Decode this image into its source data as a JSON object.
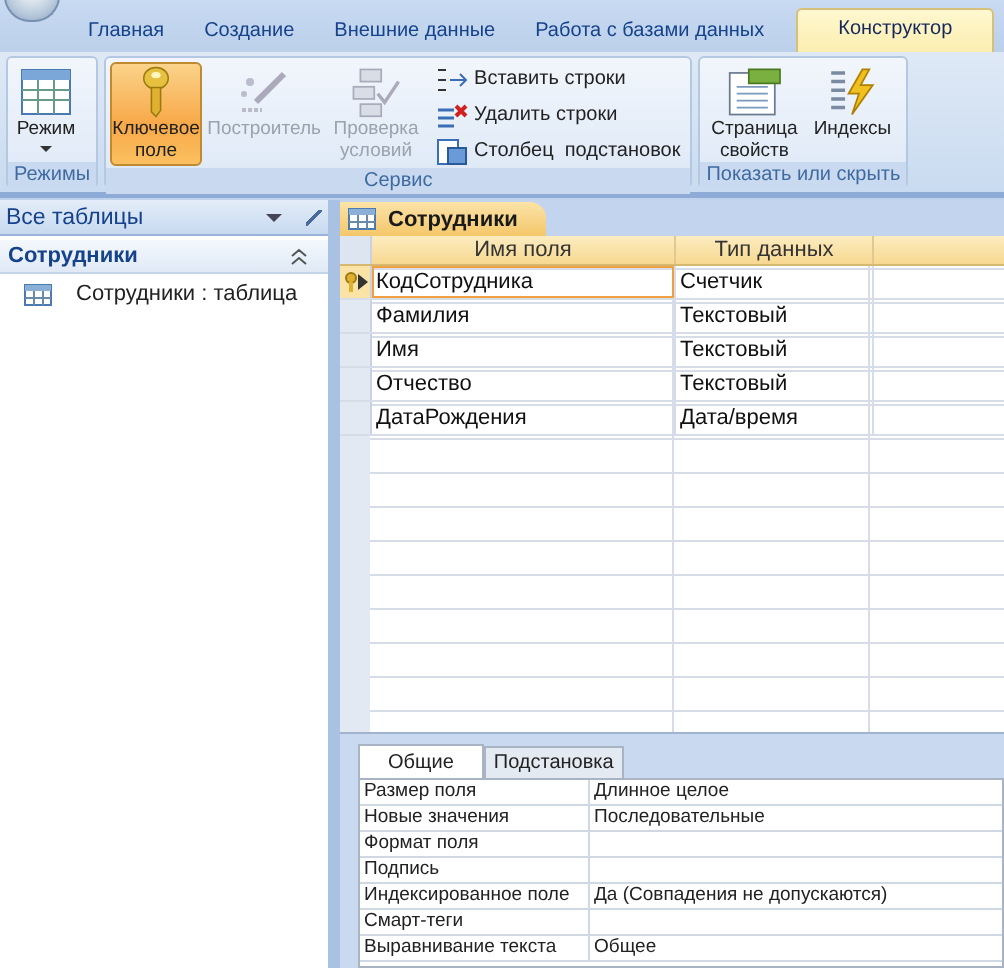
{
  "ribbon_tabs": [
    {
      "label": "Главная",
      "selected": false
    },
    {
      "label": "Создание",
      "selected": false
    },
    {
      "label": "Внешние данные",
      "selected": false
    },
    {
      "label": "Работа с базами данных",
      "selected": false
    },
    {
      "label": "Конструктор",
      "selected": true
    }
  ],
  "ribbon_groups": [
    {
      "label": "Режимы",
      "items": [
        {
          "kind": "view",
          "label": "Режим",
          "disabled": false,
          "on": false
        }
      ]
    },
    {
      "label": "Сервис",
      "items": [
        {
          "kind": "key",
          "label": "Ключевое поле",
          "disabled": false,
          "on": true
        },
        {
          "kind": "builder",
          "label": "Построитель",
          "disabled": true,
          "on": false
        },
        {
          "kind": "validate",
          "label": "Проверка условий",
          "disabled": true,
          "on": false
        },
        {
          "kind": "insert",
          "label": "Вставить строки",
          "disabled": false,
          "on": false
        },
        {
          "kind": "delete",
          "label": "Удалить строки",
          "disabled": false,
          "on": false
        },
        {
          "kind": "lookup",
          "label": "Столбец  подстановок",
          "disabled": false,
          "on": false
        }
      ]
    },
    {
      "label": "Показать или скрыть",
      "items": [
        {
          "kind": "sheet",
          "label": "Страница свойств",
          "disabled": false,
          "on": false
        },
        {
          "kind": "indexes",
          "label": "Индексы",
          "disabled": false,
          "on": false
        }
      ]
    }
  ],
  "nav_pane": {
    "title": "Все таблицы",
    "group": {
      "label": "Сотрудники",
      "expanded": true
    },
    "items": [
      {
        "label": "Сотрудники : таблица"
      }
    ]
  },
  "document_tab": {
    "label": "Сотрудники"
  },
  "design_grid": {
    "columns": [
      "Имя поля",
      "Тип данных"
    ],
    "rows": [
      {
        "field_name": "КодСотрудника",
        "data_type": "Счетчик",
        "primary_key": true,
        "current": true
      },
      {
        "field_name": "Фамилия",
        "data_type": "Текстовый",
        "primary_key": false,
        "current": false
      },
      {
        "field_name": "Имя",
        "data_type": "Текстовый",
        "primary_key": false,
        "current": false
      },
      {
        "field_name": "Отчество",
        "data_type": "Текстовый",
        "primary_key": false,
        "current": false
      },
      {
        "field_name": "ДатаРождения",
        "data_type": "Дата/время",
        "primary_key": false,
        "current": false
      }
    ]
  },
  "properties": {
    "tabs": [
      {
        "label": "Общие",
        "selected": true
      },
      {
        "label": "Подстановка",
        "selected": false
      }
    ],
    "rows": [
      {
        "label": "Размер поля",
        "value": "Длинное целое"
      },
      {
        "label": "Новые значения",
        "value": "Последовательные"
      },
      {
        "label": "Формат поля"
      },
      {
        "label": "Подпись"
      },
      {
        "label": "Индексированное поле",
        "value": "Да (Совпадения не допускаются)"
      },
      {
        "label": "Смарт-теги"
      },
      {
        "label": "Выравнивание текста",
        "value": "Общее"
      }
    ]
  }
}
